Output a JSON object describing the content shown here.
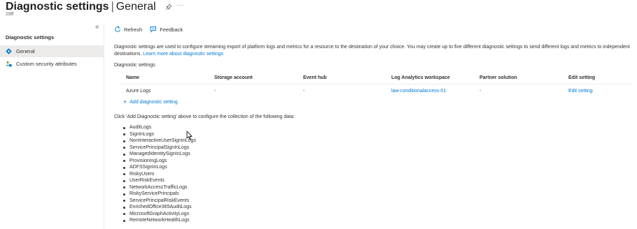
{
  "header": {
    "title": "Diagnostic settings",
    "separator": "|",
    "subtitle": "General",
    "tenant": "25fff",
    "more": "···"
  },
  "sidebar": {
    "collapse": "«",
    "title": "Diagnostic settings",
    "items": [
      {
        "label": "General",
        "icon": "gear-icon",
        "active": true
      },
      {
        "label": "Custom security attributes",
        "icon": "users-tag-icon",
        "active": false
      }
    ]
  },
  "toolbar": {
    "refresh_label": "Refresh",
    "feedback_label": "Feedback"
  },
  "description": {
    "text": "Diagnostic settings are used to configure streaming export of platform logs and metrics for a resource to the destination of your choice. You may create up to five different diagnostic settings to send different logs and metrics to independent destinations.",
    "link": "Learn more about diagnostic settings"
  },
  "settings": {
    "section_label": "Diagnostic settings",
    "columns": [
      "Name",
      "Storage account",
      "Event hub",
      "Log Analytics workspace",
      "Partner solution",
      "Edit setting"
    ],
    "rows": [
      {
        "name": "Azure Logs",
        "storage": "-",
        "eventhub": "-",
        "workspace": "law-conditionalaccess-01",
        "partner": "-",
        "edit": "Edit setting"
      }
    ],
    "add_label": "Add diagnostic setting"
  },
  "hint": "Click 'Add Diagnostic setting' above to configure the collection of the following data:",
  "log_types": [
    "AuditLogs",
    "SignInLogs",
    "NonInteractiveUserSignInLogs",
    "ServicePrincipalSignInLogs",
    "ManagedIdentitySignInLogs",
    "ProvisioningLogs",
    "ADFSSignInLogs",
    "RiskyUsers",
    "UserRiskEvents",
    "NetworkAccessTrafficLogs",
    "RiskyServicePrincipals",
    "ServicePrincipalRiskEvents",
    "EnrichedOffice365AuditLogs",
    "MicrosoftGraphActivityLogs",
    "RemoteNetworkHealthLogs"
  ],
  "colors": {
    "accent": "#0078d4",
    "text": "#323130",
    "active_bg": "#edebe9"
  }
}
